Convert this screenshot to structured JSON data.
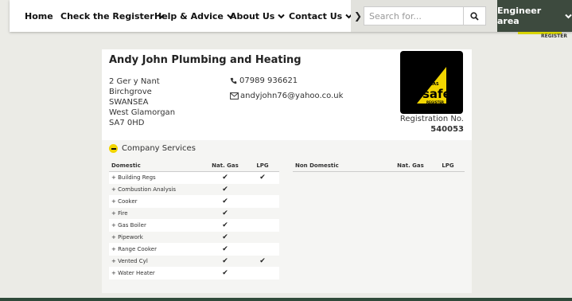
{
  "nav": {
    "items": [
      {
        "label": "Home",
        "dropdown": false
      },
      {
        "label": "Check the Register",
        "dropdown": true
      },
      {
        "label": "Help & Advice",
        "dropdown": true
      },
      {
        "label": "About Us",
        "dropdown": true
      },
      {
        "label": "Contact Us",
        "dropdown": true
      }
    ],
    "search_placeholder": "Search for...",
    "engineer_label": "Engineer area",
    "register_text": "REGISTER"
  },
  "business": {
    "name": "Andy John Plumbing and Heating",
    "address": [
      "2 Ger y Nant",
      "Birchgrove",
      "SWANSEA",
      "West Glamorgan",
      "SA7 0HD"
    ],
    "phone": "07989 936621",
    "email": "andyjohn76@yahoo.co.uk",
    "logo": {
      "gas": "GAS",
      "safe": "safe",
      "register": "REGISTER"
    },
    "registration_label": "Registration No.",
    "registration_number": "540053"
  },
  "services": {
    "heading": "Company Services",
    "domestic": {
      "headers": [
        "Domestic",
        "Nat. Gas",
        "LPG"
      ],
      "rows": [
        {
          "name": "+ Building Regs",
          "nat_gas": true,
          "lpg": true
        },
        {
          "name": "+ Combustion Analysis",
          "nat_gas": true,
          "lpg": false
        },
        {
          "name": "+ Cooker",
          "nat_gas": true,
          "lpg": false
        },
        {
          "name": "+ Fire",
          "nat_gas": true,
          "lpg": false
        },
        {
          "name": "+ Gas Boiler",
          "nat_gas": true,
          "lpg": false
        },
        {
          "name": "+ Pipework",
          "nat_gas": true,
          "lpg": false
        },
        {
          "name": "+ Range Cooker",
          "nat_gas": true,
          "lpg": false
        },
        {
          "name": "+ Vented Cyl",
          "nat_gas": true,
          "lpg": true
        },
        {
          "name": "+ Water Heater",
          "nat_gas": true,
          "lpg": false
        }
      ]
    },
    "non_domestic": {
      "headers": [
        "Non Domestic",
        "Nat. Gas",
        "LPG"
      ],
      "rows": []
    }
  },
  "colors": {
    "accent_yellow": "#f2d500",
    "engineer_bg": "#3d4a3e",
    "page_bg": "#ebebe6"
  }
}
